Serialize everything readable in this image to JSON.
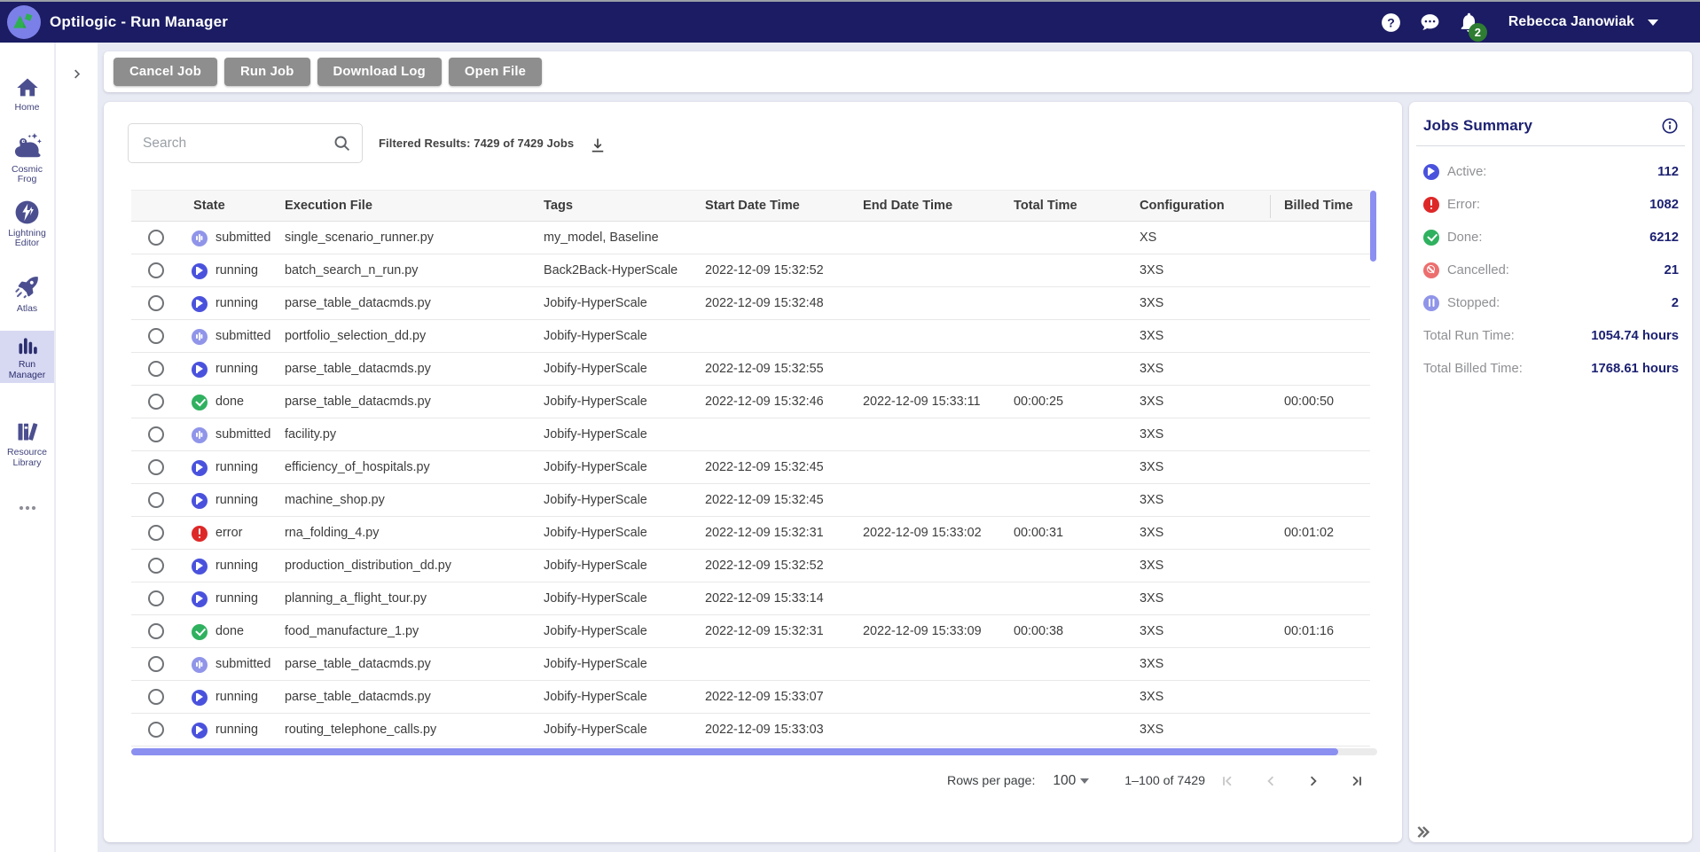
{
  "navbar": {
    "title": "Optilogic - Run Manager",
    "user": "Rebecca Janowiak",
    "notification_count": "2"
  },
  "sidebar": {
    "items": [
      {
        "label1": "Home",
        "label2": "",
        "icon": "home",
        "active": false
      },
      {
        "label1": "Cosmic",
        "label2": "Frog",
        "icon": "cosmic-frog",
        "active": false
      },
      {
        "label1": "Lightning",
        "label2": "Editor",
        "icon": "lightning-editor",
        "active": false
      },
      {
        "label1": "Atlas",
        "label2": "",
        "icon": "atlas",
        "active": false
      },
      {
        "label1": "Run",
        "label2": "Manager",
        "icon": "run-manager",
        "active": true
      },
      {
        "label1": "Resource",
        "label2": "Library",
        "icon": "resource-library",
        "active": false
      }
    ]
  },
  "toolbar": {
    "buttons": [
      {
        "label": "Cancel Job"
      },
      {
        "label": "Run Job"
      },
      {
        "label": "Download Log"
      },
      {
        "label": "Open File"
      }
    ]
  },
  "search": {
    "placeholder": "Search"
  },
  "filter_summary": "Filtered Results: 7429 of 7429 Jobs",
  "table": {
    "columns": [
      "State",
      "Execution File",
      "Tags",
      "Start Date Time",
      "End Date Time",
      "Total Time",
      "Configuration",
      "Billed Time"
    ],
    "rows": [
      {
        "kind": "submitted",
        "state": "submitted",
        "file": "single_scenario_runner.py",
        "tags": "my_model, Baseline",
        "start": "",
        "end": "",
        "total": "",
        "config": "XS",
        "billed": ""
      },
      {
        "kind": "running",
        "state": "running",
        "file": "batch_search_n_run.py",
        "tags": "Back2Back-HyperScale",
        "start": "2022-12-09 15:32:52",
        "end": "",
        "total": "",
        "config": "3XS",
        "billed": ""
      },
      {
        "kind": "running",
        "state": "running",
        "file": "parse_table_datacmds.py",
        "tags": "Jobify-HyperScale",
        "start": "2022-12-09 15:32:48",
        "end": "",
        "total": "",
        "config": "3XS",
        "billed": ""
      },
      {
        "kind": "submitted",
        "state": "submitted",
        "file": "portfolio_selection_dd.py",
        "tags": "Jobify-HyperScale",
        "start": "",
        "end": "",
        "total": "",
        "config": "3XS",
        "billed": ""
      },
      {
        "kind": "running",
        "state": "running",
        "file": "parse_table_datacmds.py",
        "tags": "Jobify-HyperScale",
        "start": "2022-12-09 15:32:55",
        "end": "",
        "total": "",
        "config": "3XS",
        "billed": ""
      },
      {
        "kind": "done",
        "state": "done",
        "file": "parse_table_datacmds.py",
        "tags": "Jobify-HyperScale",
        "start": "2022-12-09 15:32:46",
        "end": "2022-12-09 15:33:11",
        "total": "00:00:25",
        "config": "3XS",
        "billed": "00:00:50"
      },
      {
        "kind": "submitted",
        "state": "submitted",
        "file": "facility.py",
        "tags": "Jobify-HyperScale",
        "start": "",
        "end": "",
        "total": "",
        "config": "3XS",
        "billed": ""
      },
      {
        "kind": "running",
        "state": "running",
        "file": "efficiency_of_hospitals.py",
        "tags": "Jobify-HyperScale",
        "start": "2022-12-09 15:32:45",
        "end": "",
        "total": "",
        "config": "3XS",
        "billed": ""
      },
      {
        "kind": "running",
        "state": "running",
        "file": "machine_shop.py",
        "tags": "Jobify-HyperScale",
        "start": "2022-12-09 15:32:45",
        "end": "",
        "total": "",
        "config": "3XS",
        "billed": ""
      },
      {
        "kind": "error",
        "state": "error",
        "file": "rna_folding_4.py",
        "tags": "Jobify-HyperScale",
        "start": "2022-12-09 15:32:31",
        "end": "2022-12-09 15:33:02",
        "total": "00:00:31",
        "config": "3XS",
        "billed": "00:01:02"
      },
      {
        "kind": "running",
        "state": "running",
        "file": "production_distribution_dd.py",
        "tags": "Jobify-HyperScale",
        "start": "2022-12-09 15:32:52",
        "end": "",
        "total": "",
        "config": "3XS",
        "billed": ""
      },
      {
        "kind": "running",
        "state": "running",
        "file": "planning_a_flight_tour.py",
        "tags": "Jobify-HyperScale",
        "start": "2022-12-09 15:33:14",
        "end": "",
        "total": "",
        "config": "3XS",
        "billed": ""
      },
      {
        "kind": "done",
        "state": "done",
        "file": "food_manufacture_1.py",
        "tags": "Jobify-HyperScale",
        "start": "2022-12-09 15:32:31",
        "end": "2022-12-09 15:33:09",
        "total": "00:00:38",
        "config": "3XS",
        "billed": "00:01:16"
      },
      {
        "kind": "submitted",
        "state": "submitted",
        "file": "parse_table_datacmds.py",
        "tags": "Jobify-HyperScale",
        "start": "",
        "end": "",
        "total": "",
        "config": "3XS",
        "billed": ""
      },
      {
        "kind": "running",
        "state": "running",
        "file": "parse_table_datacmds.py",
        "tags": "Jobify-HyperScale",
        "start": "2022-12-09 15:33:07",
        "end": "",
        "total": "",
        "config": "3XS",
        "billed": ""
      },
      {
        "kind": "running",
        "state": "running",
        "file": "routing_telephone_calls.py",
        "tags": "Jobify-HyperScale",
        "start": "2022-12-09 15:33:03",
        "end": "",
        "total": "",
        "config": "3XS",
        "billed": ""
      }
    ]
  },
  "pagination": {
    "rows_per_page_label": "Rows per page:",
    "rows_per_page": "100",
    "range": "1–100 of 7429"
  },
  "summary": {
    "title": "Jobs Summary",
    "stats": [
      {
        "kind": "play",
        "label": "Active:",
        "value": "112"
      },
      {
        "kind": "error",
        "label": "Error:",
        "value": "1082"
      },
      {
        "kind": "done",
        "label": "Done:",
        "value": "6212"
      },
      {
        "kind": "cancelled",
        "label": "Cancelled:",
        "value": "21"
      },
      {
        "kind": "pause",
        "label": "Stopped:",
        "value": "2"
      }
    ],
    "totals": [
      {
        "label": "Total Run Time:",
        "value": "1054.74 hours"
      },
      {
        "label": "Total Billed Time:",
        "value": "1768.61 hours"
      }
    ]
  },
  "colors": {
    "navbar": "#1b1c63",
    "accent_purple": "#8a8ff0",
    "running": "#4a52dd",
    "submitted": "#9095e9",
    "done": "#2fb15f",
    "error": "#de2828",
    "cancelled": "#ed6e6e",
    "badge_green": "#2e7d32",
    "active_item_bg": "#d7d8f2"
  }
}
